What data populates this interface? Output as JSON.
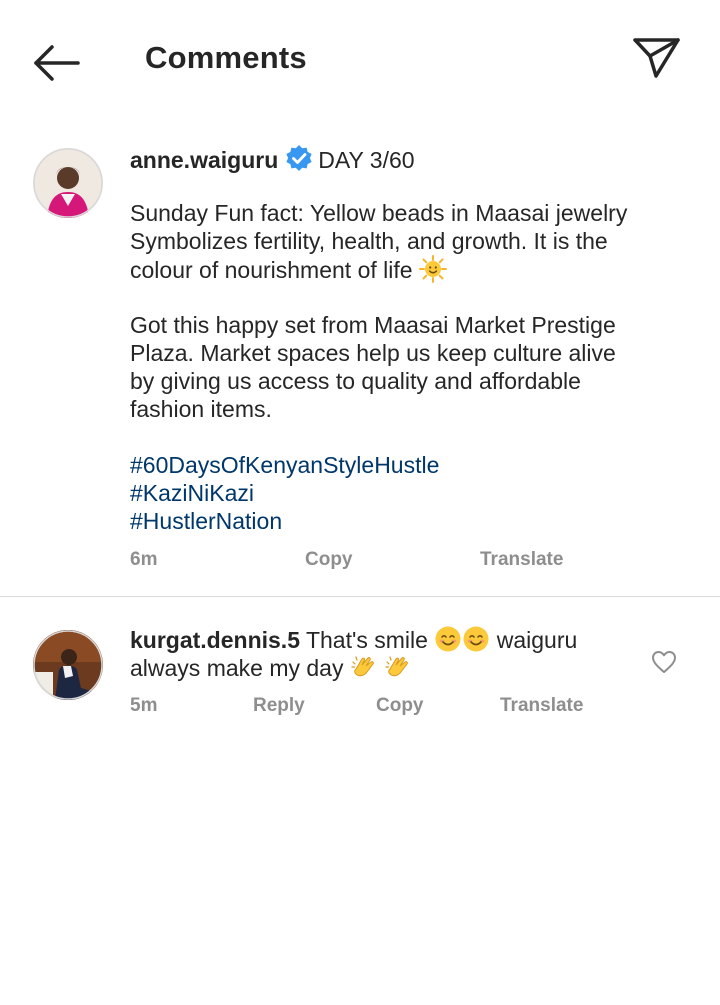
{
  "header": {
    "title": "Comments",
    "back_icon": "arrow-left-icon",
    "share_icon": "paper-plane-icon"
  },
  "caption": {
    "username": "anne.waiguru",
    "verified_icon": "verified-badge-icon",
    "first_line": "DAY 3/60",
    "paragraph1": [
      "Sunday Fun fact: Yellow beads in Maasai jewelry",
      "Symbolizes fertility, health, and growth. It is the",
      "colour of nourishment of life"
    ],
    "paragraph1_emoji": "sun-with-face-emoji",
    "paragraph2": [
      "Got this happy set from Maasai Market Prestige",
      "Plaza. Market spaces help us keep culture alive",
      "by giving us access to quality and affordable",
      "fashion items."
    ],
    "hashtags": [
      "#60DaysOfKenyanStyleHustle",
      "#KaziNiKazi",
      "#HustlerNation"
    ],
    "time": "6m",
    "copy_label": "Copy",
    "translate_label": "Translate"
  },
  "comment": {
    "username": "kurgat.dennis.5",
    "text_line1": "That's smile",
    "text_line1_after": "waiguru",
    "text_line2": "always make my day",
    "emojis_line1": [
      "smiling-face-emoji",
      "smiling-face-emoji"
    ],
    "emojis_line2": [
      "clapping-hands-emoji",
      "clapping-hands-emoji"
    ],
    "time": "5m",
    "reply_label": "Reply",
    "copy_label": "Copy",
    "translate_label": "Translate",
    "like_icon": "heart-outline-icon"
  },
  "colors": {
    "text": "#262626",
    "secondary": "#8e8e8e",
    "hashtag": "#00376b",
    "verified": "#3897f0",
    "divider": "#dbdbdb"
  }
}
